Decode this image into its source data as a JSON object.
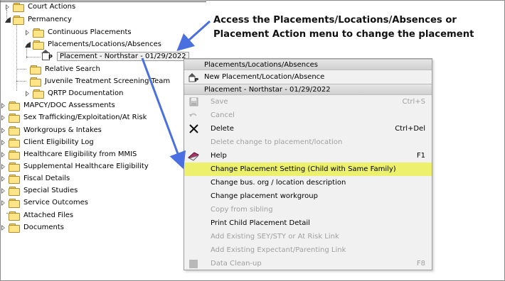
{
  "tree": {
    "items": [
      {
        "label": "Court Actions"
      },
      {
        "label": "Permanency"
      },
      {
        "label": "Continuous Placements"
      },
      {
        "label": "Placements/Locations/Absences"
      },
      {
        "label": "Placement - Northstar - 01/29/2022"
      },
      {
        "label": "Relative Search"
      },
      {
        "label": "Juvenile Treatment Screening Team"
      },
      {
        "label": "QRTP Documentation"
      },
      {
        "label": "MAPCY/DOC Assessments"
      },
      {
        "label": "Sex Trafficking/Exploitation/At Risk"
      },
      {
        "label": "Workgroups & Intakes"
      },
      {
        "label": "Client Eligibility Log"
      },
      {
        "label": "Healthcare Eligibility from MMIS"
      },
      {
        "label": "Supplemental Healthcare Eligibility"
      },
      {
        "label": "Fiscal Details"
      },
      {
        "label": "Special Studies"
      },
      {
        "label": "Service Outcomes"
      },
      {
        "label": "Attached Files"
      },
      {
        "label": "Documents"
      }
    ]
  },
  "annotation": {
    "line1": "Access the Placements/Locations/Absences or",
    "line2": "Placement Action menu to change the placement"
  },
  "menu": {
    "section1_header": "Placements/Locations/Absences",
    "new_item": "New Placement/Location/Absence",
    "section2_header": "Placement - Northstar - 01/29/2022",
    "items": [
      {
        "label": "Save",
        "shortcut": "Ctrl+S",
        "enabled": false
      },
      {
        "label": "Cancel",
        "shortcut": "",
        "enabled": false
      },
      {
        "label": "Delete",
        "shortcut": "Ctrl+Del",
        "enabled": true
      },
      {
        "label": "Delete change to placement/location",
        "shortcut": "",
        "enabled": false
      },
      {
        "label": "Help",
        "shortcut": "F1",
        "enabled": true
      },
      {
        "label": "Change Placement Setting (Child with Same Family)",
        "shortcut": "",
        "enabled": true,
        "highlighted": true
      },
      {
        "label": "Change bus. org / location description",
        "shortcut": "",
        "enabled": true
      },
      {
        "label": "Change placement workgroup",
        "shortcut": "",
        "enabled": true
      },
      {
        "label": "Copy from sibling",
        "shortcut": "",
        "enabled": false
      },
      {
        "label": "Print Child Placement Detail",
        "shortcut": "",
        "enabled": true
      },
      {
        "label": "Add Existing SEY/STY or At Risk Link",
        "shortcut": "",
        "enabled": false
      },
      {
        "label": "Add Existing Expectant/Parenting Link",
        "shortcut": "",
        "enabled": false
      },
      {
        "label": "Data Clean-up",
        "shortcut": "F8",
        "enabled": false
      }
    ]
  },
  "colors": {
    "highlight": "#ecf06d",
    "arrow": "#4a6fe0",
    "folder": "#ffe488"
  }
}
